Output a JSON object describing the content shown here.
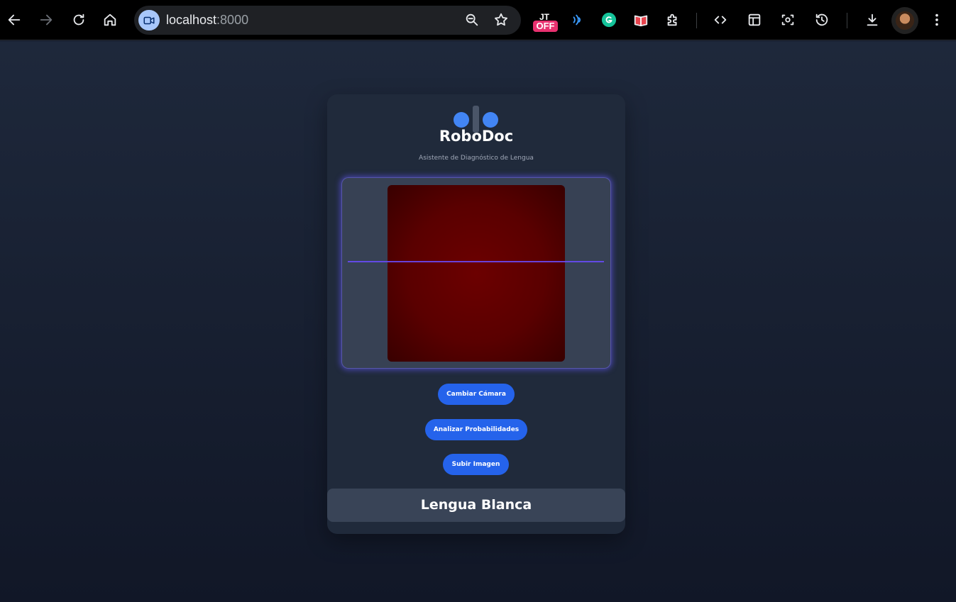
{
  "browser": {
    "url_host": "localhost",
    "url_port": ":8000",
    "extension_badge": {
      "top": "JT",
      "bottom": "OFF"
    },
    "icons": [
      "back-icon",
      "forward-icon",
      "reload-icon",
      "home-icon",
      "camera-site-icon",
      "zoom-icon",
      "star-icon",
      "extension-off-icon",
      "wireless-icon",
      "grammarly-icon",
      "reader-icon",
      "puzzle-icon",
      "code-icon",
      "layout-icon",
      "screenshot-icon",
      "history-icon",
      "download-icon",
      "avatar",
      "menu-icon"
    ]
  },
  "app": {
    "title": "RoboDoc",
    "subtitle": "Asistente de Diagnóstico de Lengua",
    "buttons": {
      "switch_camera": "Cambiar Cámara",
      "analyze": "Analizar Probabilidades",
      "upload": "Subir Imagen"
    },
    "result": "Lengua Blanca"
  },
  "colors": {
    "accent": "#2563eb",
    "logo_blue": "#4285f4",
    "scan_line": "#6a4cff",
    "card_bg": "#202a3b"
  }
}
